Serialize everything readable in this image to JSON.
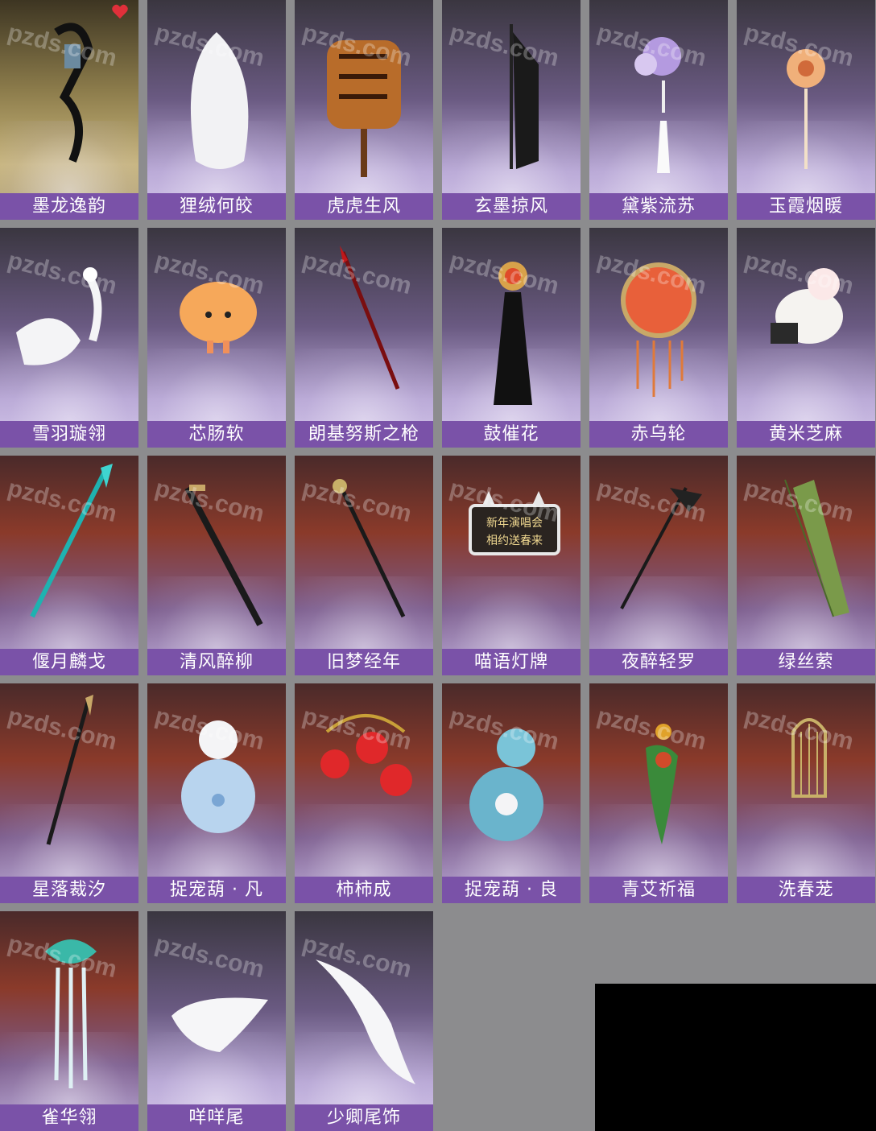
{
  "watermark": "pzds.com",
  "label_color": "#7a52a8",
  "items": [
    {
      "name": "墨龙逸韵",
      "icon": "ink-dragon-ornament-icon",
      "theme": "sand",
      "favorite": true
    },
    {
      "name": "狸绒何皎",
      "icon": "white-fur-tail-icon",
      "theme": "snow"
    },
    {
      "name": "虎虎生风",
      "icon": "tiger-costume-icon",
      "theme": "snow"
    },
    {
      "name": "玄墨掠风",
      "icon": "black-banner-icon",
      "theme": "snow"
    },
    {
      "name": "黛紫流苏",
      "icon": "purple-flower-tassel-icon",
      "theme": "snow"
    },
    {
      "name": "玉霞烟暖",
      "icon": "orange-flower-pendant-icon",
      "theme": "snow"
    },
    {
      "name": "雪羽璇翎",
      "icon": "white-peacock-icon",
      "theme": "snow"
    },
    {
      "name": "芯肠软",
      "icon": "bun-creature-icon",
      "theme": "snow"
    },
    {
      "name": "朗基努斯之枪",
      "icon": "red-spear-icon",
      "theme": "snow"
    },
    {
      "name": "鼓催花",
      "icon": "drum-banner-icon",
      "theme": "snow"
    },
    {
      "name": "赤乌轮",
      "icon": "sun-dreamcatcher-icon",
      "theme": "snow"
    },
    {
      "name": "黄米芝麻",
      "icon": "lion-dance-pet-icon",
      "theme": "snow"
    },
    {
      "name": "偃月麟戈",
      "icon": "jade-glaive-icon",
      "theme": "fire"
    },
    {
      "name": "清风醉柳",
      "icon": "black-sword-icon",
      "theme": "fire"
    },
    {
      "name": "旧梦经年",
      "icon": "dark-staff-icon",
      "theme": "fire"
    },
    {
      "name": "喵语灯牌",
      "icon": "cat-sign-icon",
      "theme": "fire",
      "sign_text": [
        "新年演唱会",
        "相约送春来"
      ]
    },
    {
      "name": "夜醉轻罗",
      "icon": "night-parasol-icon",
      "theme": "fire"
    },
    {
      "name": "绿丝萦",
      "icon": "green-umbrella-icon",
      "theme": "fire"
    },
    {
      "name": "星落裁汐",
      "icon": "star-spear-icon",
      "theme": "fire"
    },
    {
      "name": "捉宠葫 · 凡",
      "icon": "blue-gourd-icon",
      "theme": "fire"
    },
    {
      "name": "柿柿成",
      "icon": "persimmon-octopus-icon",
      "theme": "fire"
    },
    {
      "name": "捉宠葫 · 良",
      "icon": "teal-gourd-icon",
      "theme": "fire"
    },
    {
      "name": "青艾祈福",
      "icon": "green-bird-charm-icon",
      "theme": "fire"
    },
    {
      "name": "洗春茏",
      "icon": "bird-cage-icon",
      "theme": "fire"
    },
    {
      "name": "雀华翎",
      "icon": "jade-hairpin-icon",
      "theme": "fire"
    },
    {
      "name": "咩咩尾",
      "icon": "white-tail-icon",
      "theme": "snow"
    },
    {
      "name": "少卿尾饰",
      "icon": "long-white-tail-icon",
      "theme": "snow"
    }
  ]
}
